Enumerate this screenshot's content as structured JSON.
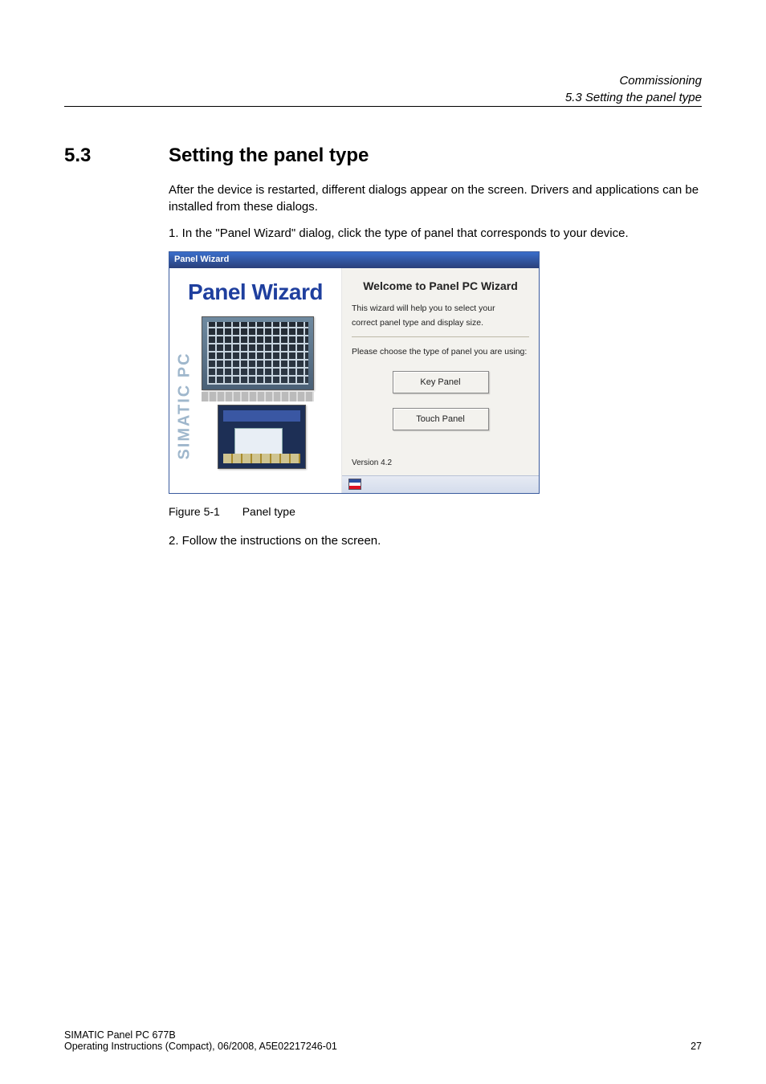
{
  "header": {
    "chapter": "Commissioning",
    "subsection": "5.3 Setting the panel type"
  },
  "section": {
    "number": "5.3",
    "title": "Setting the panel type"
  },
  "paragraphs": {
    "intro": "After the device is restarted, different dialogs appear on the screen. Drivers and applications can be installed from these dialogs.",
    "step1": "1.  In the \"Panel Wizard\" dialog, click the type of panel that corresponds to your device.",
    "step2": "2.  Follow the instructions on the screen."
  },
  "dialog": {
    "titlebar": "Panel Wizard",
    "logo": "Panel Wizard",
    "vertical_brand": "SIMATIC PC",
    "welcome": "Welcome to Panel PC Wizard",
    "help_line1": "This wizard will help you to select your",
    "help_line2": "correct panel type and display size.",
    "choose": "Please choose the type of panel you are using:",
    "buttons": {
      "key": "Key Panel",
      "touch": "Touch Panel"
    },
    "version": "Version  4.2"
  },
  "figure": {
    "number": "Figure 5-1",
    "caption": "Panel type"
  },
  "footer": {
    "line1": "SIMATIC Panel PC 677B",
    "line2": "Operating Instructions (Compact), 06/2008, A5E02217246-01",
    "page": "27"
  }
}
